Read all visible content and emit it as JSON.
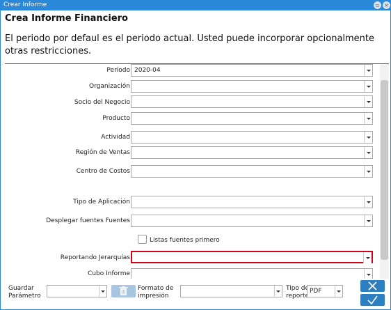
{
  "window": {
    "title": "Crear Informe"
  },
  "heading": "Crea Informe Financiero",
  "description": "El periodo por defaul es el periodo actual. Usted puede incorporar opcionalmente otras restricciones.",
  "fields": [
    {
      "label": "Período",
      "value": "2020-04"
    },
    {
      "label": "Organización",
      "value": ""
    },
    {
      "label": "Socio del Negocio",
      "value": ""
    },
    {
      "label": "Producto",
      "value": ""
    },
    {
      "label": "Actividad",
      "value": ""
    },
    {
      "label": "Región de Ventas",
      "value": ""
    },
    {
      "label": "Centro de Costos",
      "value": ""
    },
    {
      "label": "Tipo de Aplicación",
      "value": ""
    },
    {
      "label": "Desplegar fuentes Fuentes",
      "value": ""
    },
    {
      "label": "Reportando Jerarquías",
      "value": ""
    },
    {
      "label": "Cubo Informe",
      "value": ""
    }
  ],
  "checkbox": {
    "label": "Listas fuentes primero",
    "checked": false
  },
  "footer": {
    "save_param_label_1": "Guardar",
    "save_param_label_2": "Parámetro",
    "save_param_value": "",
    "format_label_1": "Formato de",
    "format_label_2": "impresión",
    "format_value": "",
    "report_type_label_1": "Tipo de",
    "report_type_label_2": "reporte",
    "report_type_value": "PDF"
  },
  "colors": {
    "titlebar": "#2989d8",
    "primary_button": "#2d7fbf",
    "required_border": "#d0021b"
  },
  "icons": {
    "minimize": "minimize-icon",
    "close": "close-icon",
    "trash": "trash-icon",
    "cancel": "x-icon",
    "ok": "check-icon"
  }
}
